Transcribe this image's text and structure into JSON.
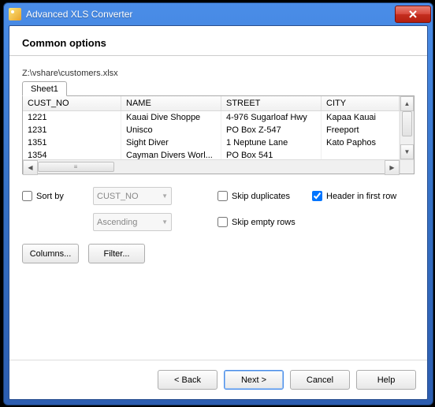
{
  "window": {
    "title": "Advanced XLS Converter"
  },
  "header": "Common options",
  "filepath": "Z:\\vshare\\customers.xlsx",
  "tabs": [
    "Sheet1"
  ],
  "grid": {
    "columns": [
      "CUST_NO",
      "NAME",
      "STREET",
      "CITY"
    ],
    "rows": [
      {
        "c0": "1221",
        "c1": "Kauai Dive Shoppe",
        "c2": "4-976 Sugarloaf Hwy",
        "c3": "Kapaa Kauai"
      },
      {
        "c0": "1231",
        "c1": "Unisco",
        "c2": "PO Box Z-547",
        "c3": "Freeport"
      },
      {
        "c0": "1351",
        "c1": "Sight Diver",
        "c2": "1 Neptune Lane",
        "c3": "Kato Paphos"
      },
      {
        "c0": "1354",
        "c1": "Cayman Divers Worl...",
        "c2": "PO Box 541",
        "c3": ""
      }
    ]
  },
  "options": {
    "sort_by_label": "Sort by",
    "sort_by_field": "CUST_NO",
    "sort_dir": "Ascending",
    "skip_duplicates": "Skip duplicates",
    "skip_empty": "Skip empty rows",
    "header_first_row": "Header in first row",
    "header_first_row_checked": true,
    "columns_btn": "Columns...",
    "filter_btn": "Filter..."
  },
  "footer": {
    "back": "< Back",
    "next": "Next >",
    "cancel": "Cancel",
    "help": "Help"
  }
}
